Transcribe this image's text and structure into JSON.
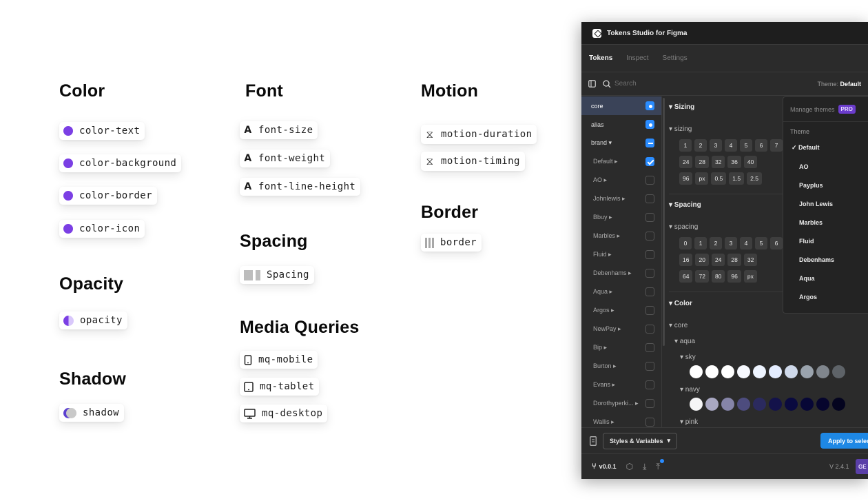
{
  "categories": {
    "color": {
      "title": "Color",
      "items": [
        "color-text",
        "color-background",
        "color-border",
        "color-icon"
      ]
    },
    "opacity": {
      "title": "Opacity",
      "items": [
        "opacity"
      ]
    },
    "shadow": {
      "title": "Shadow",
      "items": [
        "shadow"
      ]
    },
    "font": {
      "title": "Font",
      "items": [
        "font-size",
        "font-weight",
        "font-line-height"
      ]
    },
    "spacing": {
      "title": "Spacing",
      "items": [
        "Spacing"
      ]
    },
    "media": {
      "title": "Media Queries",
      "items": [
        "mq-mobile",
        "mq-tablet",
        "mq-desktop"
      ]
    },
    "motion": {
      "title": "Motion",
      "items": [
        "motion-duration",
        "motion-timing"
      ]
    },
    "border": {
      "title": "Border",
      "items": [
        "border"
      ]
    }
  },
  "icons": {
    "accent": "#7b3fe4",
    "font": "A"
  },
  "plugin": {
    "title": "Tokens Studio for Figma",
    "tabs": [
      "Tokens",
      "Inspect",
      "Settings"
    ],
    "search_placeholder": "Search",
    "theme_label": "Theme:",
    "theme_value": "Default",
    "sets": [
      {
        "name": "core",
        "state": "radio"
      },
      {
        "name": "alias",
        "state": "radio"
      },
      {
        "name": "brand ▾",
        "state": "dash"
      },
      {
        "name": "Default ▸",
        "state": "check"
      },
      {
        "name": "AO ▸",
        "state": "off"
      },
      {
        "name": "Johnlewis ▸",
        "state": "off"
      },
      {
        "name": "Bbuy ▸",
        "state": "off"
      },
      {
        "name": "Marbles ▸",
        "state": "off"
      },
      {
        "name": "Fluid ▸",
        "state": "off"
      },
      {
        "name": "Debenhams ▸",
        "state": "off"
      },
      {
        "name": "Aqua ▸",
        "state": "off"
      },
      {
        "name": "Argos ▸",
        "state": "off"
      },
      {
        "name": "NewPay ▸",
        "state": "off"
      },
      {
        "name": "Bip ▸",
        "state": "off"
      },
      {
        "name": "Burton ▸",
        "state": "off"
      },
      {
        "name": "Evans ▸",
        "state": "off"
      },
      {
        "name": "Dorothyperki... ▸",
        "state": "off"
      },
      {
        "name": "Wallis ▸",
        "state": "off"
      }
    ],
    "sizing": {
      "section": "▾ Sizing",
      "group": "▾ sizing",
      "rows": [
        [
          "1",
          "2",
          "3",
          "4",
          "5",
          "6",
          "7"
        ],
        [
          "24",
          "28",
          "32",
          "36",
          "40"
        ],
        [
          "96",
          "px",
          "0.5",
          "1.5",
          "2.5"
        ]
      ]
    },
    "spacing": {
      "section": "▾ Spacing",
      "group": "▾ spacing",
      "rows": [
        [
          "0",
          "1",
          "2",
          "3",
          "4",
          "5",
          "6"
        ],
        [
          "16",
          "20",
          "24",
          "28",
          "32"
        ],
        [
          "64",
          "72",
          "80",
          "96",
          "px"
        ]
      ]
    },
    "color": {
      "section": "▾ Color",
      "group": "▾ core",
      "subgroup": "▾ aqua",
      "sky_label": "▾ sky",
      "sky": [
        "#ffffff",
        "#ffffff",
        "#ffffff",
        "#f7f9ff",
        "#eef4ff",
        "#e4edff",
        "#cfd9ea",
        "#9aa3ad",
        "#80868d",
        "#5e6368"
      ],
      "navy_label": "▾ navy",
      "navy": [
        "#f5f5f7",
        "#a9a8c2",
        "#8584a8",
        "#4d4c7e",
        "#2b2a5e",
        "#13124a",
        "#0a0a3f",
        "#070736",
        "#06052d",
        "#04041f"
      ],
      "pink_label": "▾ pink"
    },
    "themes_menu": {
      "header": "Manage themes",
      "badge": "PRO",
      "label": "Theme",
      "items": [
        "✓ Default",
        "AO",
        "Payplus",
        "John Lewis",
        "Marbles",
        "Fluid",
        "Debenhams",
        "Aqua",
        "Argos"
      ]
    },
    "styles_button": "Styles & Variables",
    "apply_button": "Apply to selec",
    "branch": "v0.0.1",
    "version": "V 2.4.1",
    "get_pro": "GE"
  }
}
